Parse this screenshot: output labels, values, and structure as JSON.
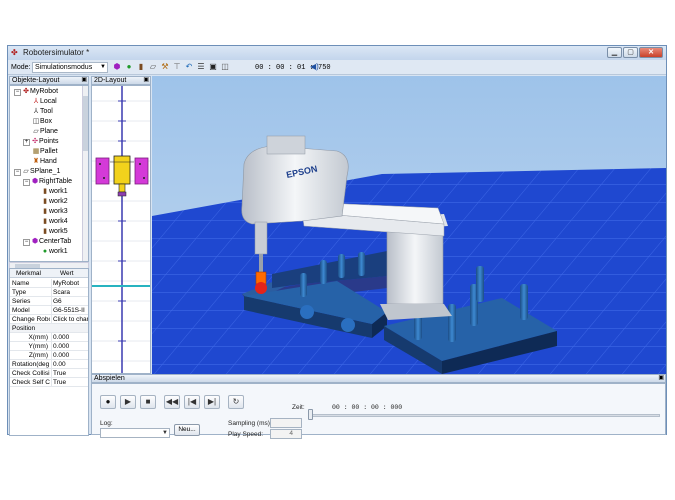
{
  "window": {
    "title": "Robotersimulator *",
    "app_icon": "robot-app-icon",
    "min_symbol": "▁",
    "max_symbol": "▢",
    "close_symbol": "✕"
  },
  "toolbar": {
    "mode_label": "Mode:",
    "mode_value": "Simulationsmodus",
    "time": "00 : 00 : 01 : 750",
    "icons": [
      "purple-cube-icon",
      "green-sphere-icon",
      "cylinder-icon",
      "plane-icon",
      "tool-icon",
      "pin-icon",
      "undo-icon",
      "list-icon",
      "camera-icon",
      "view-icon",
      "volume-icon"
    ]
  },
  "objects_panel": {
    "title": "Objekte-Layout",
    "tree": [
      {
        "label": "MyRobot",
        "icon": "robot-icon",
        "indent": 0,
        "expander": "−"
      },
      {
        "label": "Local",
        "icon": "local-frame-icon",
        "indent": 1
      },
      {
        "label": "Tool",
        "icon": "tool-frame-icon",
        "indent": 1
      },
      {
        "label": "Box",
        "icon": "box-icon",
        "indent": 1
      },
      {
        "label": "Plane",
        "icon": "plane-icon",
        "indent": 1
      },
      {
        "label": "Points",
        "icon": "points-icon",
        "indent": 1,
        "expander": "+"
      },
      {
        "label": "Pallet",
        "icon": "pallet-icon",
        "indent": 1
      },
      {
        "label": "Hand",
        "icon": "hand-icon",
        "indent": 1
      },
      {
        "label": "SPlane_1",
        "icon": "plane-icon",
        "indent": 0,
        "expander": "−"
      },
      {
        "label": "RightTable",
        "icon": "table-icon",
        "indent": 1,
        "expander": "−"
      },
      {
        "label": "work1",
        "icon": "cylinder-icon",
        "indent": 2
      },
      {
        "label": "work2",
        "icon": "cylinder-icon",
        "indent": 2
      },
      {
        "label": "work3",
        "icon": "cylinder-icon",
        "indent": 2
      },
      {
        "label": "work4",
        "icon": "cylinder-icon",
        "indent": 2
      },
      {
        "label": "work5",
        "icon": "cylinder-icon",
        "indent": 2
      },
      {
        "label": "CenterTab",
        "icon": "table-icon",
        "indent": 1,
        "expander": "−"
      },
      {
        "label": "work1",
        "icon": "green-sphere-icon",
        "indent": 2
      }
    ]
  },
  "properties": {
    "col_key": "Merkmal",
    "col_value": "Wert",
    "rows": [
      {
        "key": "Name",
        "value": "MyRobot"
      },
      {
        "key": "Type",
        "value": "Scara"
      },
      {
        "key": "Series",
        "value": "G6"
      },
      {
        "key": "Model",
        "value": "G6-551S-II"
      },
      {
        "key": "Change Robo",
        "value": "Click to chan"
      },
      {
        "key": "Position",
        "value": "",
        "group": true
      },
      {
        "key": "X(mm)",
        "value": "0.000",
        "indent": true
      },
      {
        "key": "Y(mm)",
        "value": "0.000",
        "indent": true
      },
      {
        "key": "Z(mm)",
        "value": "0.000",
        "indent": true
      },
      {
        "key": "Rotation(deg",
        "value": "0.00"
      },
      {
        "key": "Check Collisi",
        "value": "True"
      },
      {
        "key": "Check Self C",
        "value": "True"
      }
    ]
  },
  "layout2d": {
    "title": "2D-Layout"
  },
  "scene": {
    "robot_label": "EPSON"
  },
  "playback": {
    "title": "Abspielen",
    "buttons": [
      {
        "name": "record-button",
        "symbol": "●"
      },
      {
        "name": "play-button",
        "symbol": "▶"
      },
      {
        "name": "stop-button",
        "symbol": "■"
      },
      {
        "name": "rewind-button",
        "symbol": "◀◀"
      },
      {
        "name": "skip-start-button",
        "symbol": "|◀"
      },
      {
        "name": "skip-end-button",
        "symbol": "▶|"
      },
      {
        "name": "loop-button",
        "symbol": "↻"
      }
    ],
    "zeit_label": "Zeit:",
    "zeit_value": "00 : 00 : 00 : 000",
    "log_label": "Log:",
    "log_value": "",
    "new_button": "Neu...",
    "sampling_label": "Sampling (ms):",
    "sampling_value": "",
    "play_speed_label": "Play Speed:",
    "play_speed_value": "4",
    "slider_position": 0
  }
}
